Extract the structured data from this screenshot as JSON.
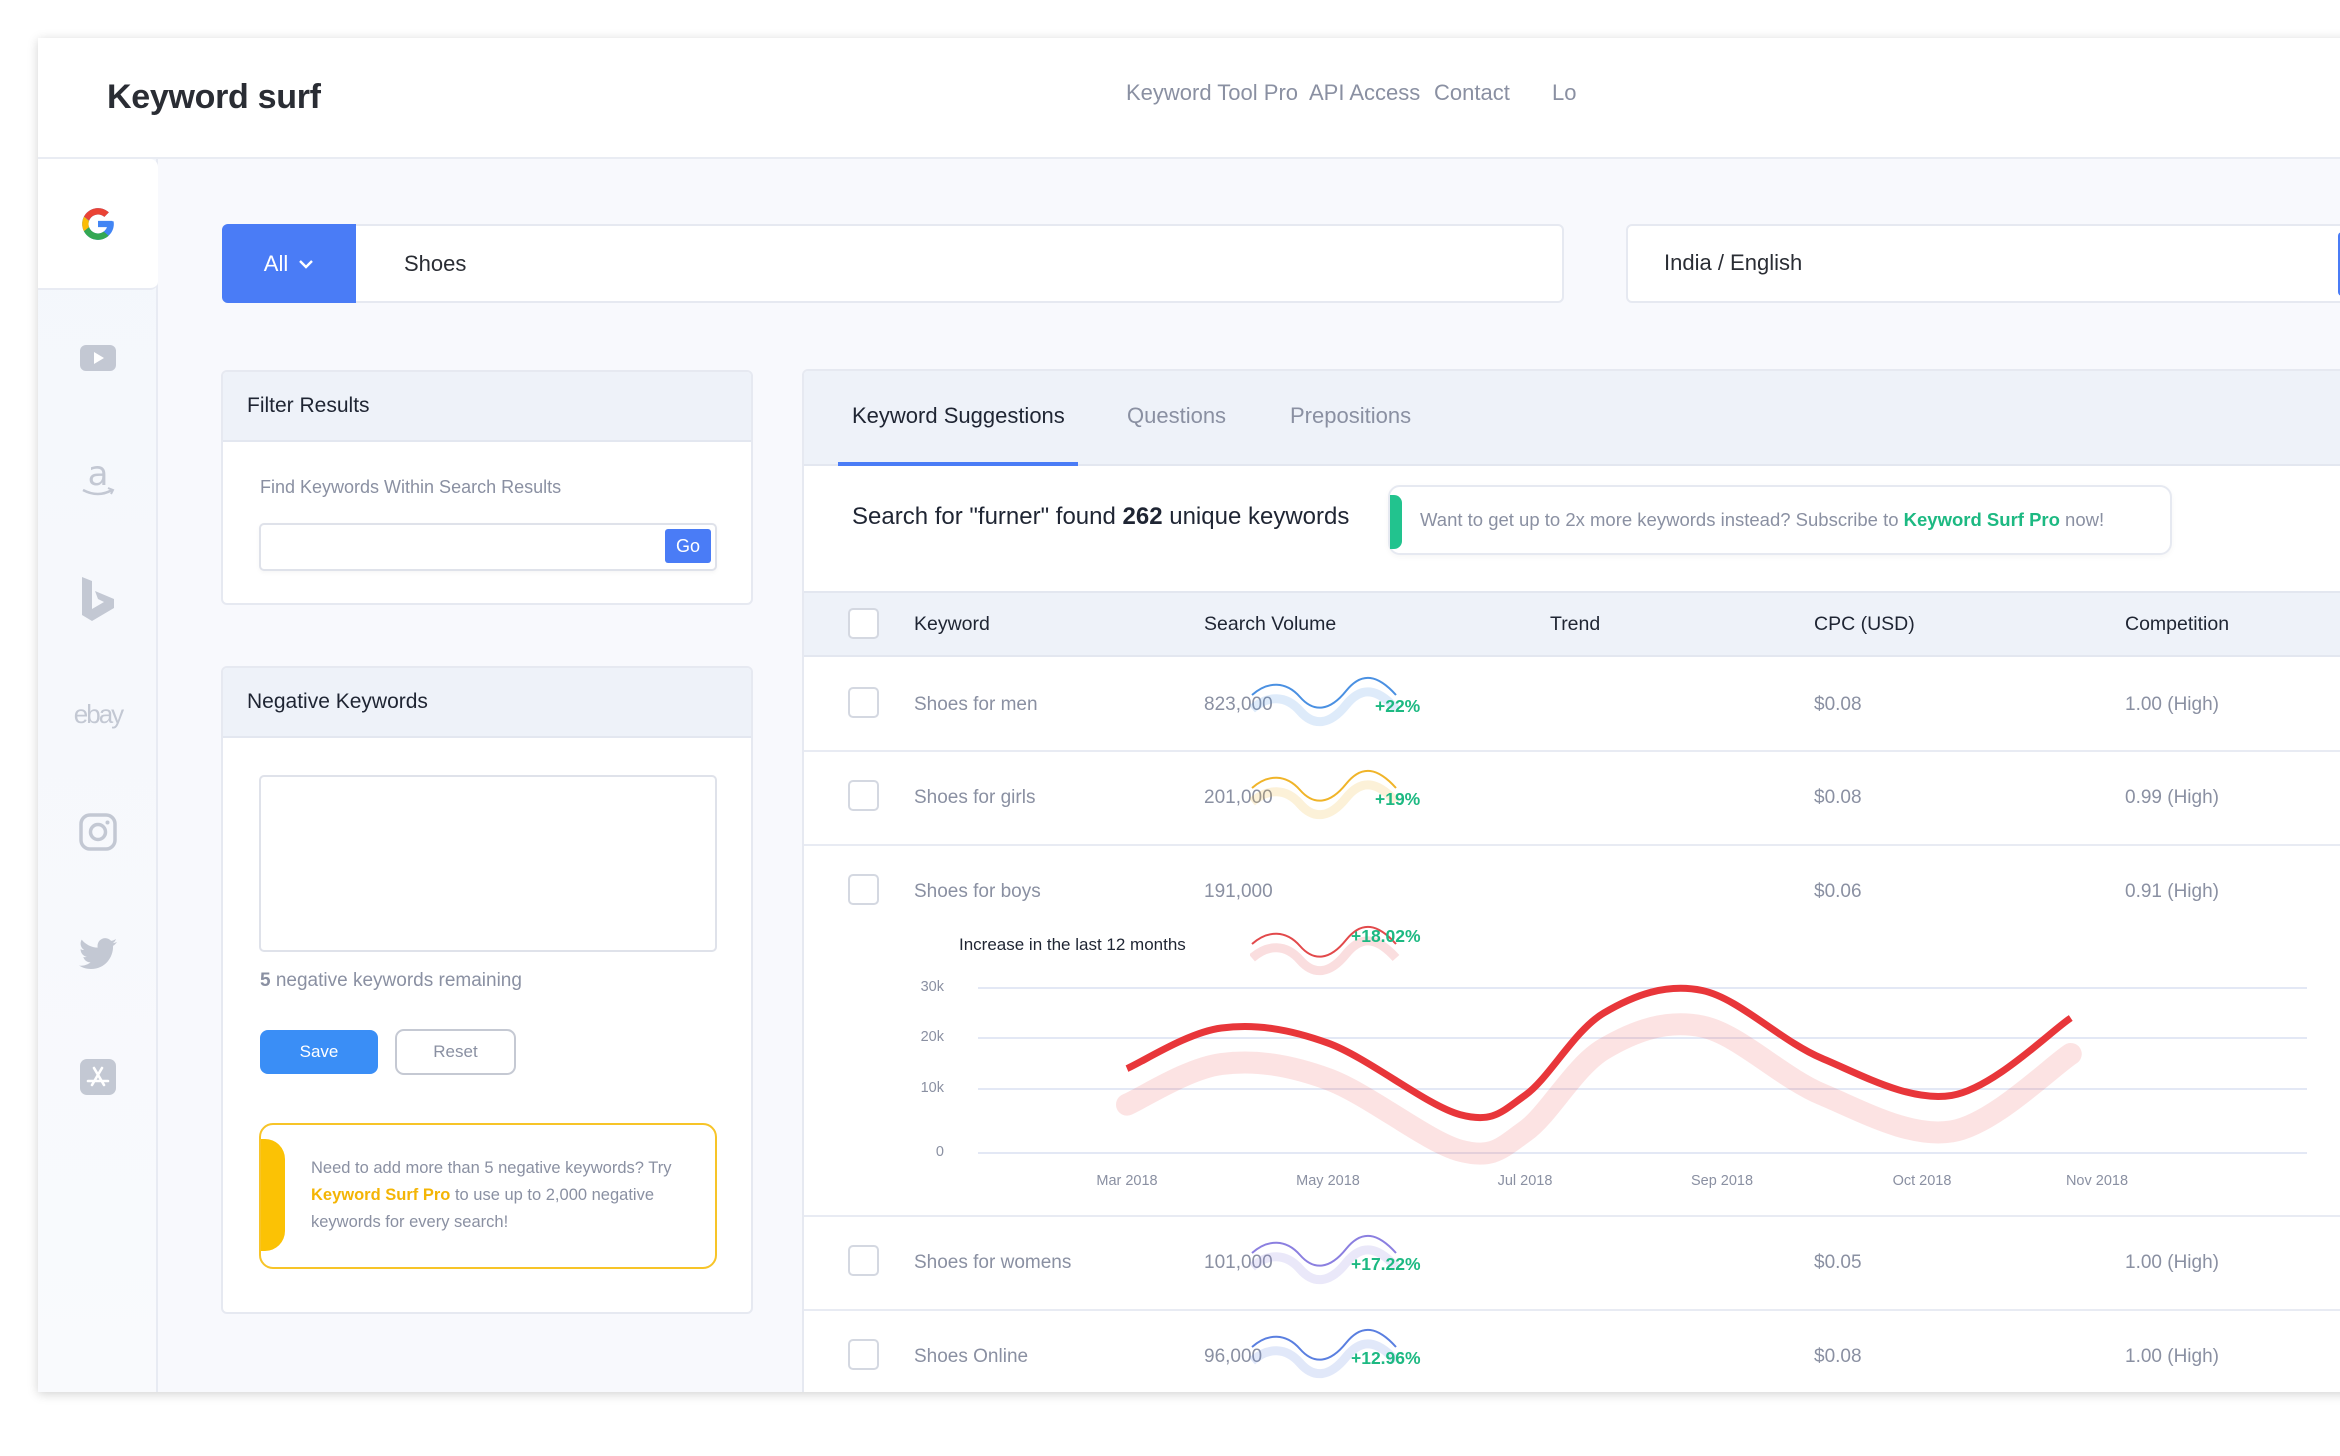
{
  "app": {
    "title": "Keyword surf",
    "nav": [
      "Keyword Tool Pro",
      "API Access",
      "Contact",
      "Lo"
    ]
  },
  "sidebar": {
    "items": [
      {
        "name": "google",
        "active": true
      },
      {
        "name": "youtube",
        "active": false
      },
      {
        "name": "amazon",
        "active": false
      },
      {
        "name": "bing",
        "active": false
      },
      {
        "name": "ebay",
        "active": false,
        "label": "ebay"
      },
      {
        "name": "instagram",
        "active": false
      },
      {
        "name": "twitter",
        "active": false
      },
      {
        "name": "app-store",
        "active": false
      }
    ]
  },
  "search": {
    "scope_label": "All",
    "query": "Shoes",
    "country_language": "India / English"
  },
  "filter": {
    "title": "Filter Results",
    "label": "Find Keywords Within Search Results",
    "value": "",
    "go_label": "Go"
  },
  "negative": {
    "title": "Negative Keywords",
    "value": "",
    "remaining_count": "5",
    "remaining_text": " negative keywords remaining",
    "save_label": "Save",
    "reset_label": "Reset",
    "promo_pre": "Need to add more than 5 negative keywords? Try ",
    "promo_link": "Keyword Surf Pro",
    "promo_post": " to use up to 2,000 negative keywords for every search!"
  },
  "results": {
    "tabs": [
      {
        "label": "Keyword Suggestions",
        "active": true
      },
      {
        "label": "Questions",
        "active": false
      },
      {
        "label": "Prepositions",
        "active": false
      }
    ],
    "summary_pre": "Search for \"furner\" found ",
    "summary_count": "262",
    "summary_post": " unique keywords",
    "banner_pre": "Want to get up to 2x more keywords instead? Subscribe to ",
    "banner_link": "Keyword Surf Pro",
    "banner_post": " now!",
    "columns": [
      "Keyword",
      "Search Volume",
      "Trend",
      "CPC (USD)",
      "Competition"
    ],
    "rows": [
      {
        "keyword": "Shoes for men",
        "volume": "823,000",
        "trend": "+22%",
        "trend_color": "#4a90e2",
        "cpc": "$0.08",
        "competition": "1.00 (High)"
      },
      {
        "keyword": "Shoes for girls",
        "volume": "201,000",
        "trend": "+19%",
        "trend_color": "#f0b429",
        "cpc": "$0.08",
        "competition": "0.99 (High)"
      },
      {
        "keyword": "Shoes for boys",
        "volume": "191,000",
        "trend": "+18.02%",
        "trend_color": "#e2494b",
        "cpc": "$0.06",
        "competition": "0.91 (High)",
        "expanded": true
      },
      {
        "keyword": "Shoes for womens",
        "volume": "101,000",
        "trend": "+17.22%",
        "trend_color": "#8b7fe0",
        "cpc": "$0.05",
        "competition": "1.00 (High)"
      },
      {
        "keyword": "Shoes Online",
        "volume": "96,000",
        "trend": "+12.96%",
        "trend_color": "#5a7fe0",
        "cpc": "$0.08",
        "competition": "1.00 (High)"
      }
    ]
  },
  "colors": {
    "accent": "#4a7cf6",
    "save": "#3a8ef6",
    "positive": "#1db982",
    "promo_yellow": "#fbc205",
    "chart_line": "#e8363a"
  },
  "chart_data": {
    "type": "line",
    "title": "Increase in the last 12 months",
    "xlabel": "",
    "ylabel": "",
    "x_tick_labels": [
      "Mar 2018",
      "May 2018",
      "Jul 2018",
      "Sep 2018",
      "Oct 2018",
      "Nov 2018"
    ],
    "y_tick_labels": [
      "0",
      "10k",
      "20k",
      "30k"
    ],
    "ylim": [
      0,
      30000
    ],
    "grid": true,
    "series": [
      {
        "name": "Shoes for boys",
        "x": [
          "Mar 2018",
          "Apr 2018",
          "May 2018",
          "Jun 2018",
          "Jul 2018",
          "Aug 2018",
          "Sep 2018",
          "Oct 2018",
          "Oct 2018 (late)",
          "Nov 2018"
        ],
        "x_pos": [
          0,
          0.47,
          1,
          1.67,
          2,
          2.4,
          2.9,
          3.5,
          4.17,
          4.85
        ],
        "values": [
          14000,
          22000,
          19000,
          6000,
          9000,
          25000,
          29500,
          16000,
          9000,
          24000
        ]
      }
    ]
  }
}
